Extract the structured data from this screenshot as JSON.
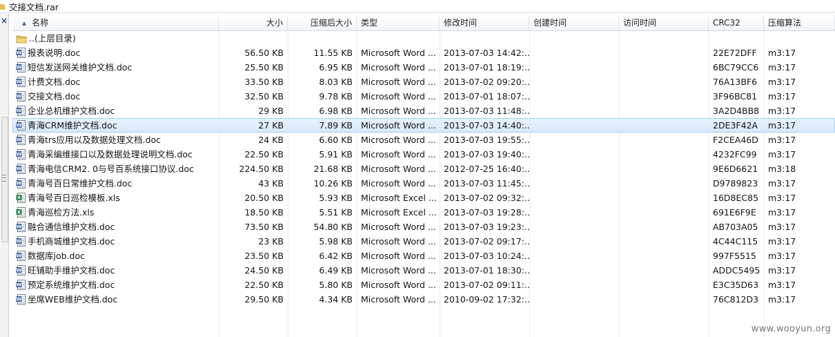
{
  "window": {
    "title": "交接文档.rar"
  },
  "columns": [
    {
      "key": "name",
      "label": "名称"
    },
    {
      "key": "size",
      "label": "大小"
    },
    {
      "key": "packed",
      "label": "压缩后大小"
    },
    {
      "key": "type",
      "label": "类型"
    },
    {
      "key": "modified",
      "label": "修改时间"
    },
    {
      "key": "created",
      "label": "创建时间"
    },
    {
      "key": "accessed",
      "label": "访问时间"
    },
    {
      "key": "crc",
      "label": "CRC32"
    },
    {
      "key": "method",
      "label": "压缩算法"
    }
  ],
  "parent_row": {
    "name": "..(上层目录)"
  },
  "rows": [
    {
      "icon": "word-doc-icon",
      "name": "报表说明.doc",
      "size": "56.50 KB",
      "packed": "11.55 KB",
      "type": "Microsoft Word ...",
      "modified": "2013-07-03 14:42:...",
      "crc": "22E72DFF",
      "method": "m3:17"
    },
    {
      "icon": "word-doc-icon",
      "name": "短信发送网关维护文档.doc",
      "size": "25.50 KB",
      "packed": "6.95 KB",
      "type": "Microsoft Word ...",
      "modified": "2013-07-01 18:19:...",
      "crc": "6BC79CC6",
      "method": "m3:17"
    },
    {
      "icon": "word-doc-icon",
      "name": "计费文档.doc",
      "size": "33.50 KB",
      "packed": "8.03 KB",
      "type": "Microsoft Word ...",
      "modified": "2013-07-02 09:20:...",
      "crc": "76A13BF6",
      "method": "m3:17"
    },
    {
      "icon": "word-doc-icon",
      "name": "交接文档.doc",
      "size": "32.50 KB",
      "packed": "9.78 KB",
      "type": "Microsoft Word ...",
      "modified": "2013-07-01 18:07:...",
      "crc": "3F96BC81",
      "method": "m3:17"
    },
    {
      "icon": "word-doc-icon",
      "name": "企业总机维护文档.doc",
      "size": "29 KB",
      "packed": "6.98 KB",
      "type": "Microsoft Word ...",
      "modified": "2013-07-03 11:48:...",
      "crc": "3A2D4BB8",
      "method": "m3:17"
    },
    {
      "icon": "word-doc-icon",
      "name": "青海CRM维护文档.doc",
      "size": "27 KB",
      "packed": "7.89 KB",
      "type": "Microsoft Word ...",
      "modified": "2013-07-03 14:40:...",
      "crc": "2DE3F42A",
      "method": "m3:17",
      "selected": true
    },
    {
      "icon": "word-doc-icon",
      "name": "青海trs应用以及数据处理文档.doc",
      "size": "24 KB",
      "packed": "6.60 KB",
      "type": "Microsoft Word ...",
      "modified": "2013-07-03 19:55:...",
      "crc": "F2CEA46D",
      "method": "m3:17"
    },
    {
      "icon": "word-doc-icon",
      "name": "青海采编维接口以及数据处理说明文档.doc",
      "size": "22.50 KB",
      "packed": "5.91 KB",
      "type": "Microsoft Word ...",
      "modified": "2013-07-03 19:40:...",
      "crc": "4232FC99",
      "method": "m3:17"
    },
    {
      "icon": "word-doc-icon",
      "name": "青海电信CRM2. 0与号百系统接口协议.doc",
      "size": "224.50 KB",
      "packed": "21.68 KB",
      "type": "Microsoft Word ...",
      "modified": "2012-07-25 16:40:...",
      "crc": "9E6D6621",
      "method": "m3:18"
    },
    {
      "icon": "word-doc-icon",
      "name": "青海号百日常维护文档.doc",
      "size": "43 KB",
      "packed": "10.26 KB",
      "type": "Microsoft Word ...",
      "modified": "2013-07-03 11:45:...",
      "crc": "D9789823",
      "method": "m3:17"
    },
    {
      "icon": "excel-xls-icon",
      "name": "青海号百日巡检模板.xls",
      "size": "20.50 KB",
      "packed": "5.93 KB",
      "type": "Microsoft Excel ...",
      "modified": "2013-07-02 09:32:...",
      "crc": "16D8EC85",
      "method": "m3:17"
    },
    {
      "icon": "excel-xls-icon",
      "name": "青海巡检方法.xls",
      "size": "18.50 KB",
      "packed": "5.51 KB",
      "type": "Microsoft Excel ...",
      "modified": "2013-07-03 19:28:...",
      "crc": "691E6F9E",
      "method": "m3:17"
    },
    {
      "icon": "word-doc-icon",
      "name": "融合通信维护文档.doc",
      "size": "73.50 KB",
      "packed": "54.80 KB",
      "type": "Microsoft Word ...",
      "modified": "2013-07-03 19:23:...",
      "crc": "AB703A05",
      "method": "m3:17"
    },
    {
      "icon": "word-doc-icon",
      "name": "手机商城维护文档.doc",
      "size": "23 KB",
      "packed": "5.98 KB",
      "type": "Microsoft Word ...",
      "modified": "2013-07-02 09:17:...",
      "crc": "4C44C115",
      "method": "m3:17"
    },
    {
      "icon": "word-doc-icon",
      "name": "数据库job.doc",
      "size": "23.50 KB",
      "packed": "6.42 KB",
      "type": "Microsoft Word ...",
      "modified": "2013-07-03 10:24:...",
      "crc": "997F5515",
      "method": "m3:17"
    },
    {
      "icon": "word-doc-icon",
      "name": "旺铺助手维护文档.doc",
      "size": "24.50 KB",
      "packed": "6.49 KB",
      "type": "Microsoft Word ...",
      "modified": "2013-07-01 18:30:...",
      "crc": "ADDC5495",
      "method": "m3:17"
    },
    {
      "icon": "word-doc-icon",
      "name": "预定系统维护文档.doc",
      "size": "22.50 KB",
      "packed": "5.80 KB",
      "type": "Microsoft Word ...",
      "modified": "2013-07-02 09:11:...",
      "crc": "E3C35D63",
      "method": "m3:17"
    },
    {
      "icon": "word-doc-icon",
      "name": "坐席WEB维护文档.doc",
      "size": "29.50 KB",
      "packed": "4.34 KB",
      "type": "Microsoft Word ...",
      "modified": "2010-09-02 17:32:...",
      "crc": "76C812D3",
      "method": "m3:17"
    }
  ],
  "watermark": "www.wooyun.org",
  "colors": {
    "selection": "#d6e9fb",
    "word_icon": "#2b579a",
    "excel_icon": "#217346",
    "folder": "#e8c15a"
  }
}
